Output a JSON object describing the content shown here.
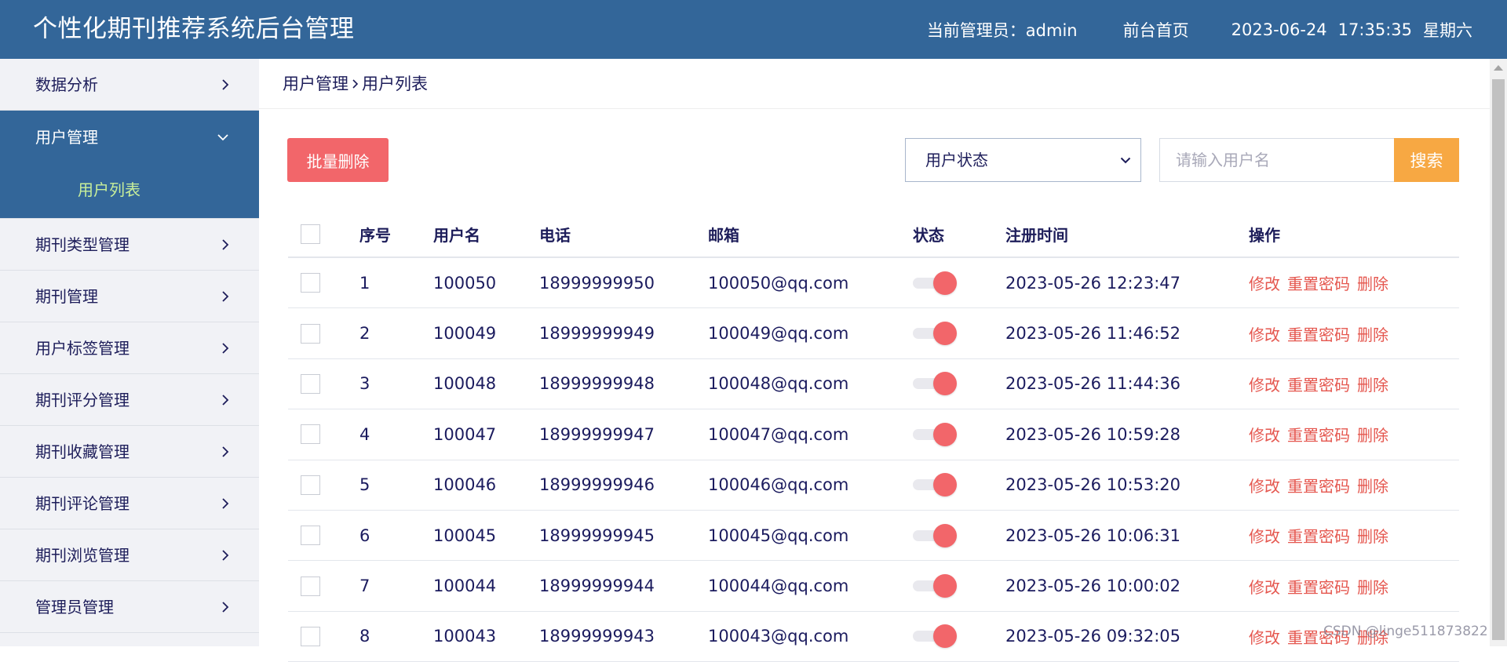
{
  "header": {
    "title": "个性化期刊推荐系统后台管理",
    "admin_label": "当前管理员：admin",
    "home_link": "前台首页",
    "date": "2023-06-24",
    "time": "17:35:35",
    "weekday": "星期六"
  },
  "sidebar": {
    "items": [
      {
        "label": "数据分析"
      },
      {
        "label": "用户管理"
      },
      {
        "label": "期刊类型管理"
      },
      {
        "label": "期刊管理"
      },
      {
        "label": "用户标签管理"
      },
      {
        "label": "期刊评分管理"
      },
      {
        "label": "期刊收藏管理"
      },
      {
        "label": "期刊评论管理"
      },
      {
        "label": "期刊浏览管理"
      },
      {
        "label": "管理员管理"
      }
    ],
    "active_sub": "用户列表"
  },
  "breadcrumb": {
    "parent": "用户管理",
    "current": "用户列表"
  },
  "toolbar": {
    "batch_delete": "批量删除",
    "status_select": "用户状态",
    "search_placeholder": "请输入用户名",
    "search_button": "搜索"
  },
  "table": {
    "headers": {
      "index": "序号",
      "username": "用户名",
      "phone": "电话",
      "email": "邮箱",
      "status": "状态",
      "created": "注册时间",
      "actions": "操作"
    },
    "actions": {
      "edit": "修改",
      "reset": "重置密码",
      "delete": "删除"
    },
    "rows": [
      {
        "idx": "1",
        "username": "100050",
        "phone": "18999999950",
        "email": "100050@qq.com",
        "created": "2023-05-26 12:23:47"
      },
      {
        "idx": "2",
        "username": "100049",
        "phone": "18999999949",
        "email": "100049@qq.com",
        "created": "2023-05-26 11:46:52"
      },
      {
        "idx": "3",
        "username": "100048",
        "phone": "18999999948",
        "email": "100048@qq.com",
        "created": "2023-05-26 11:44:36"
      },
      {
        "idx": "4",
        "username": "100047",
        "phone": "18999999947",
        "email": "100047@qq.com",
        "created": "2023-05-26 10:59:28"
      },
      {
        "idx": "5",
        "username": "100046",
        "phone": "18999999946",
        "email": "100046@qq.com",
        "created": "2023-05-26 10:53:20"
      },
      {
        "idx": "6",
        "username": "100045",
        "phone": "18999999945",
        "email": "100045@qq.com",
        "created": "2023-05-26 10:06:31"
      },
      {
        "idx": "7",
        "username": "100044",
        "phone": "18999999944",
        "email": "100044@qq.com",
        "created": "2023-05-26 10:00:02"
      },
      {
        "idx": "8",
        "username": "100043",
        "phone": "18999999943",
        "email": "100043@qq.com",
        "created": "2023-05-26 09:32:05"
      }
    ]
  },
  "watermark": "CSDN @linge511873822",
  "colors": {
    "header_bg": "#336699",
    "danger": "#f2666a",
    "warning": "#f7a843",
    "sub_active": "#c8ef9a"
  }
}
